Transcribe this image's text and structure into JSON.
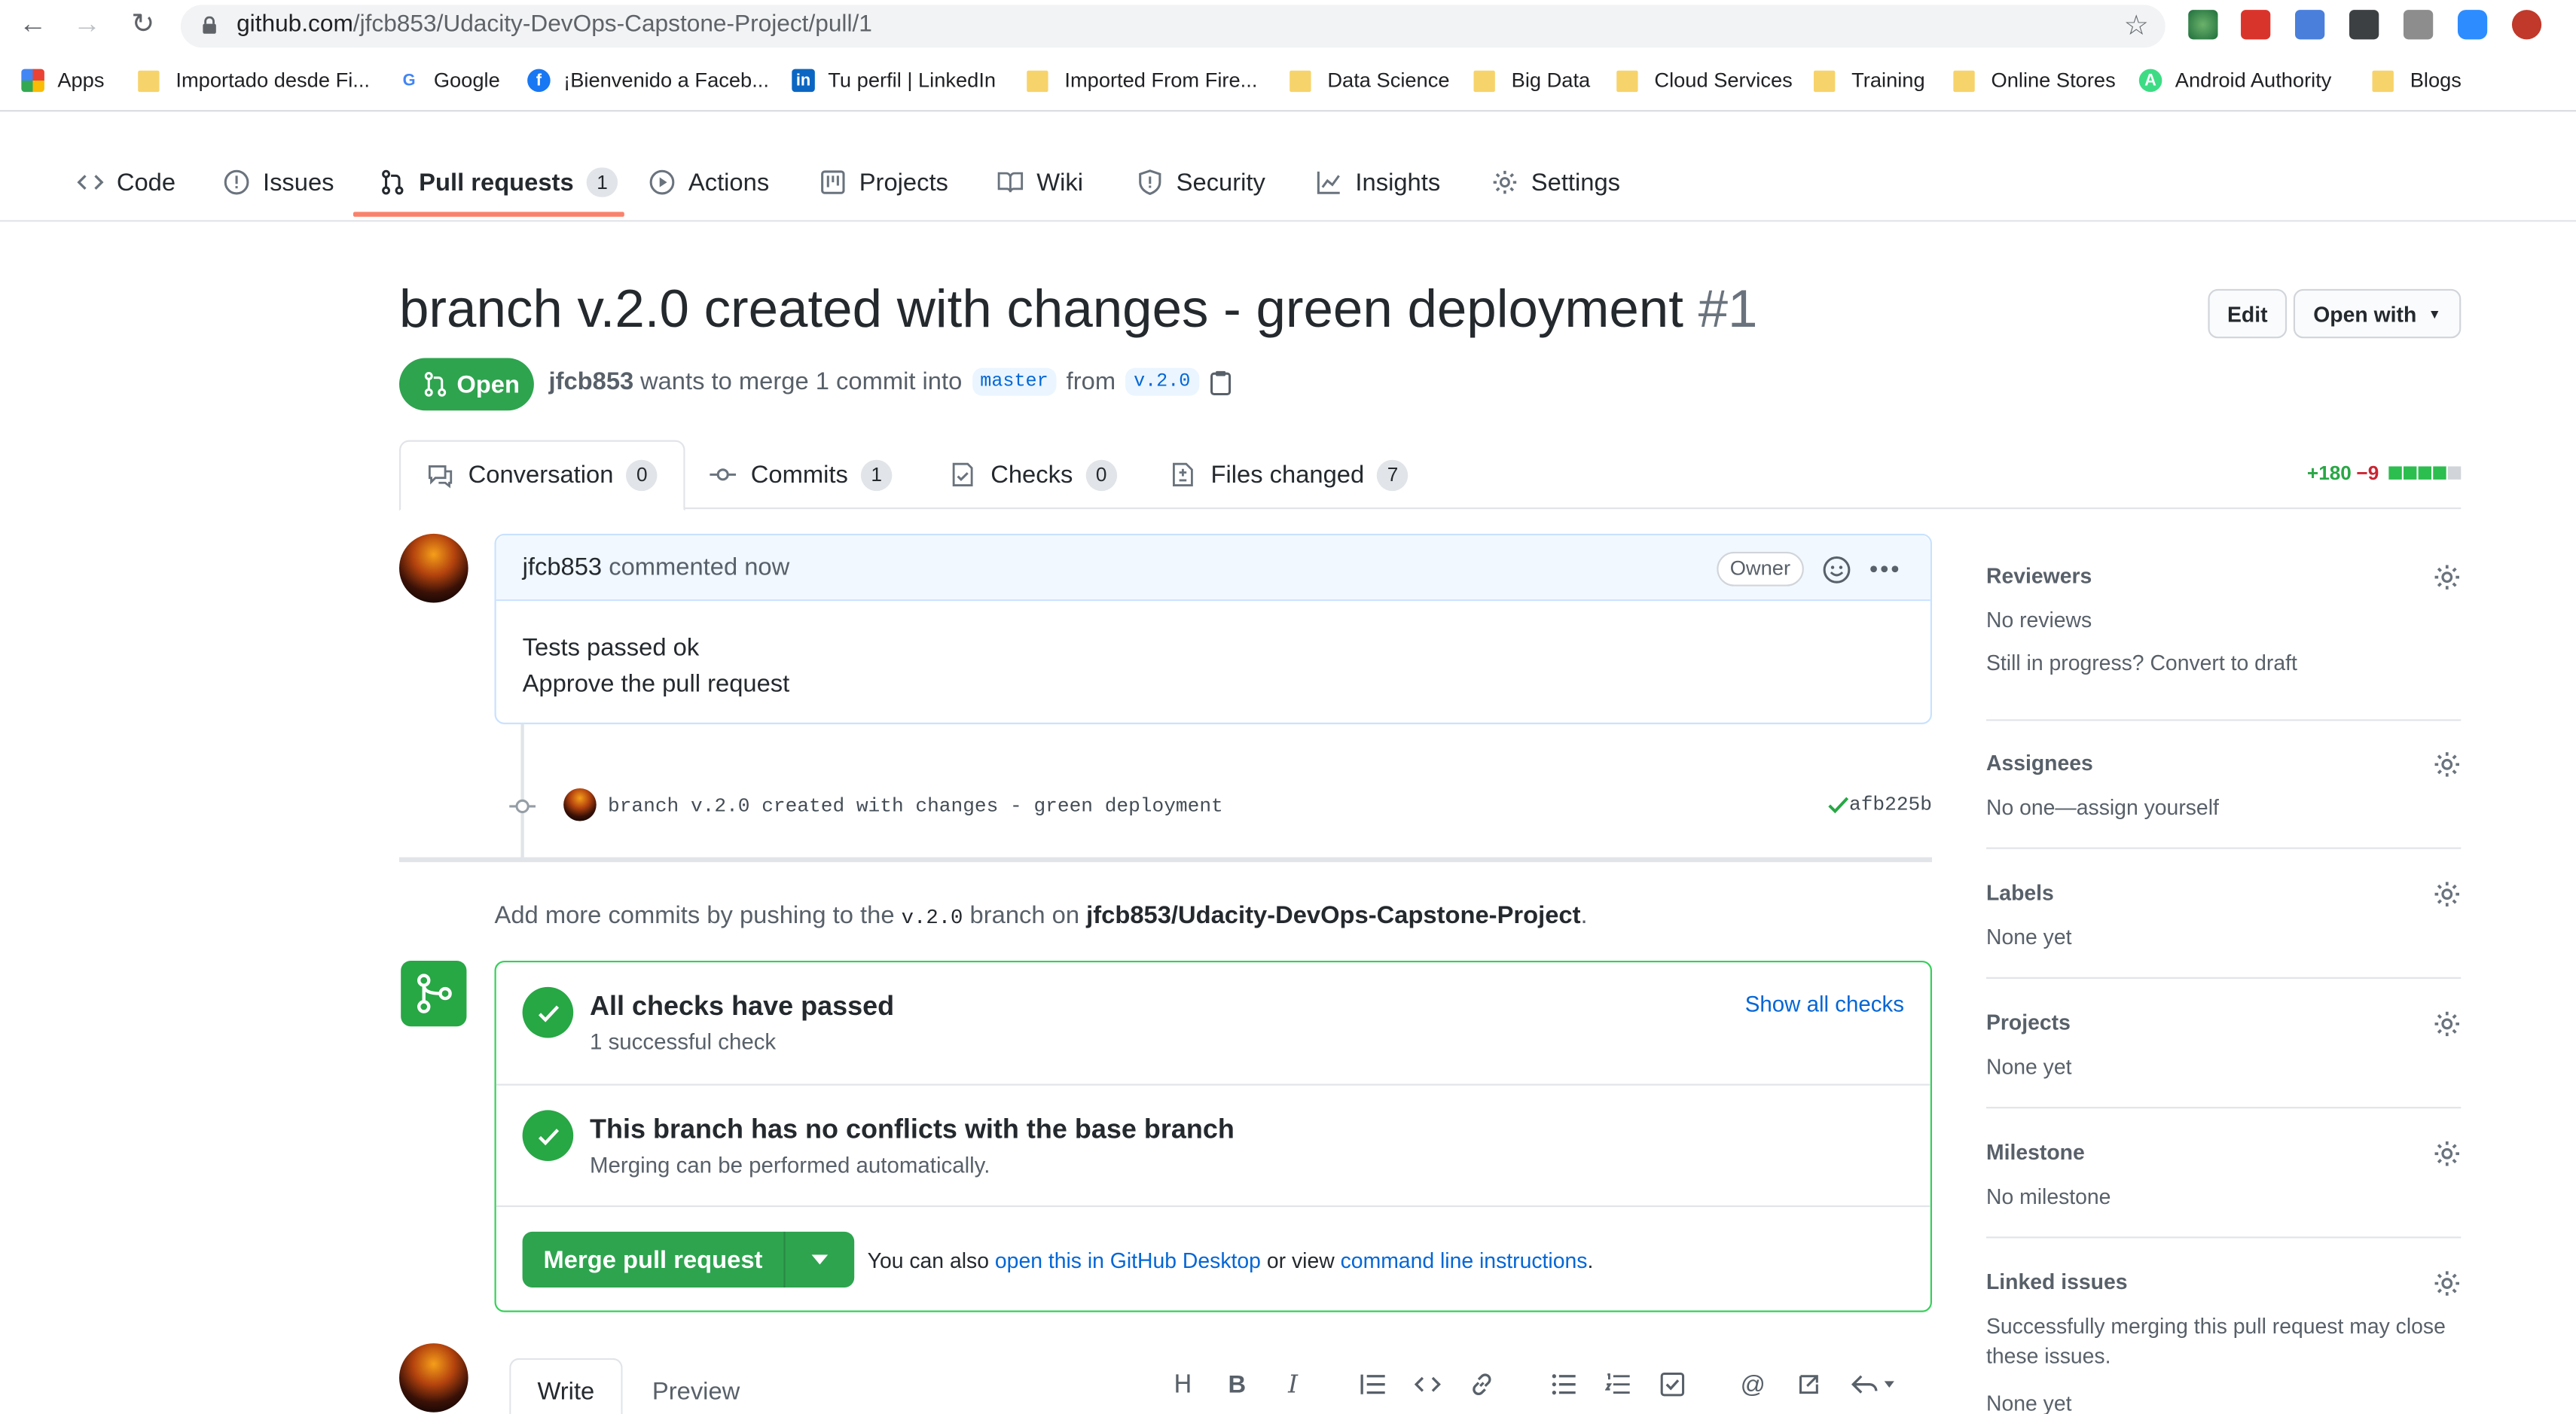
{
  "browser": {
    "url_host": "github.com",
    "url_path": "/jfcb853/Udacity-DevOps-Capstone-Project/pull/1",
    "bookmarks": [
      {
        "label": "Apps",
        "icon": "apps-grid-icon"
      },
      {
        "label": "Importado desde Fi...",
        "icon": "folder-icon"
      },
      {
        "label": "Google",
        "icon": "google-icon"
      },
      {
        "label": "¡Bienvenido a Faceb...",
        "icon": "facebook-icon"
      },
      {
        "label": "Tu perfil | LinkedIn",
        "icon": "linkedin-icon"
      },
      {
        "label": "Imported From Fire...",
        "icon": "folder-icon"
      },
      {
        "label": "Data Science",
        "icon": "folder-icon"
      },
      {
        "label": "Big Data",
        "icon": "folder-icon"
      },
      {
        "label": "Cloud Services",
        "icon": "folder-icon"
      },
      {
        "label": "Training",
        "icon": "folder-icon"
      },
      {
        "label": "Online Stores",
        "icon": "folder-icon"
      },
      {
        "label": "Android Authority",
        "icon": "android-authority-icon"
      },
      {
        "label": "Blogs",
        "icon": "folder-icon"
      }
    ]
  },
  "repo_nav": {
    "items": [
      {
        "label": "Code",
        "icon": "code-icon"
      },
      {
        "label": "Issues",
        "icon": "issue-icon"
      },
      {
        "label": "Pull requests",
        "icon": "pull-request-icon",
        "count": "1"
      },
      {
        "label": "Actions",
        "icon": "play-icon"
      },
      {
        "label": "Projects",
        "icon": "project-icon"
      },
      {
        "label": "Wiki",
        "icon": "book-icon"
      },
      {
        "label": "Security",
        "icon": "shield-icon"
      },
      {
        "label": "Insights",
        "icon": "graph-icon"
      },
      {
        "label": "Settings",
        "icon": "gear-icon"
      }
    ]
  },
  "pr": {
    "title": "branch v.2.0 created with changes - green deployment",
    "number": "#1",
    "edit_label": "Edit",
    "open_with_label": "Open with",
    "state": "Open",
    "author": "jfcb853",
    "merge_text": "wants to merge 1 commit into",
    "base_ref": "master",
    "from_text": "from",
    "head_ref": "v.2.0"
  },
  "tabs": [
    {
      "label": "Conversation",
      "count": "0",
      "icon": "comment-discussion-icon"
    },
    {
      "label": "Commits",
      "count": "1",
      "icon": "commit-icon"
    },
    {
      "label": "Checks",
      "count": "0",
      "icon": "checklist-icon"
    },
    {
      "label": "Files changed",
      "count": "7",
      "icon": "file-diff-icon"
    }
  ],
  "diffstat": {
    "additions": "+180",
    "deletions": "−9"
  },
  "comment": {
    "author": "jfcb853",
    "action": "commented now",
    "badge": "Owner",
    "body_line1": "Tests passed ok",
    "body_line2": "Approve the pull request"
  },
  "commit": {
    "message": "branch v.2.0 created with changes - green deployment",
    "sha": "afb225b"
  },
  "push_note": {
    "prefix": "Add more commits by pushing to the",
    "branch": "v.2.0",
    "middle": "branch on",
    "repo": "jfcb853/Udacity-DevOps-Capstone-Project",
    "suffix": "."
  },
  "merge": {
    "checks_title": "All checks have passed",
    "checks_sub": "1 successful check",
    "show_all": "Show all checks",
    "conflict_title": "This branch has no conflicts with the base branch",
    "conflict_sub": "Merging can be performed automatically.",
    "merge_button": "Merge pull request",
    "also_prefix": "You can also",
    "desktop_link": "open this in GitHub Desktop",
    "also_middle": "or view",
    "cli_link": "command line instructions",
    "also_suffix": "."
  },
  "sidebar": {
    "reviewers": {
      "title": "Reviewers",
      "line1": "No reviews",
      "line2": "Still in progress? Convert to draft"
    },
    "assignees": {
      "title": "Assignees",
      "value": "No one—assign yourself"
    },
    "labels": {
      "title": "Labels",
      "value": "None yet"
    },
    "projects": {
      "title": "Projects",
      "value": "None yet"
    },
    "milestone": {
      "title": "Milestone",
      "value": "No milestone"
    },
    "linked": {
      "title": "Linked issues",
      "line1": "Successfully merging this pull request may close",
      "line2": "these issues.",
      "line3": "None yet"
    }
  },
  "editor": {
    "write_tab": "Write",
    "preview_tab": "Preview"
  },
  "colors": {
    "green": "#2ea44f",
    "link": "#0366d6",
    "active_underline": "#f9826c",
    "deletion": "#cb2431"
  }
}
